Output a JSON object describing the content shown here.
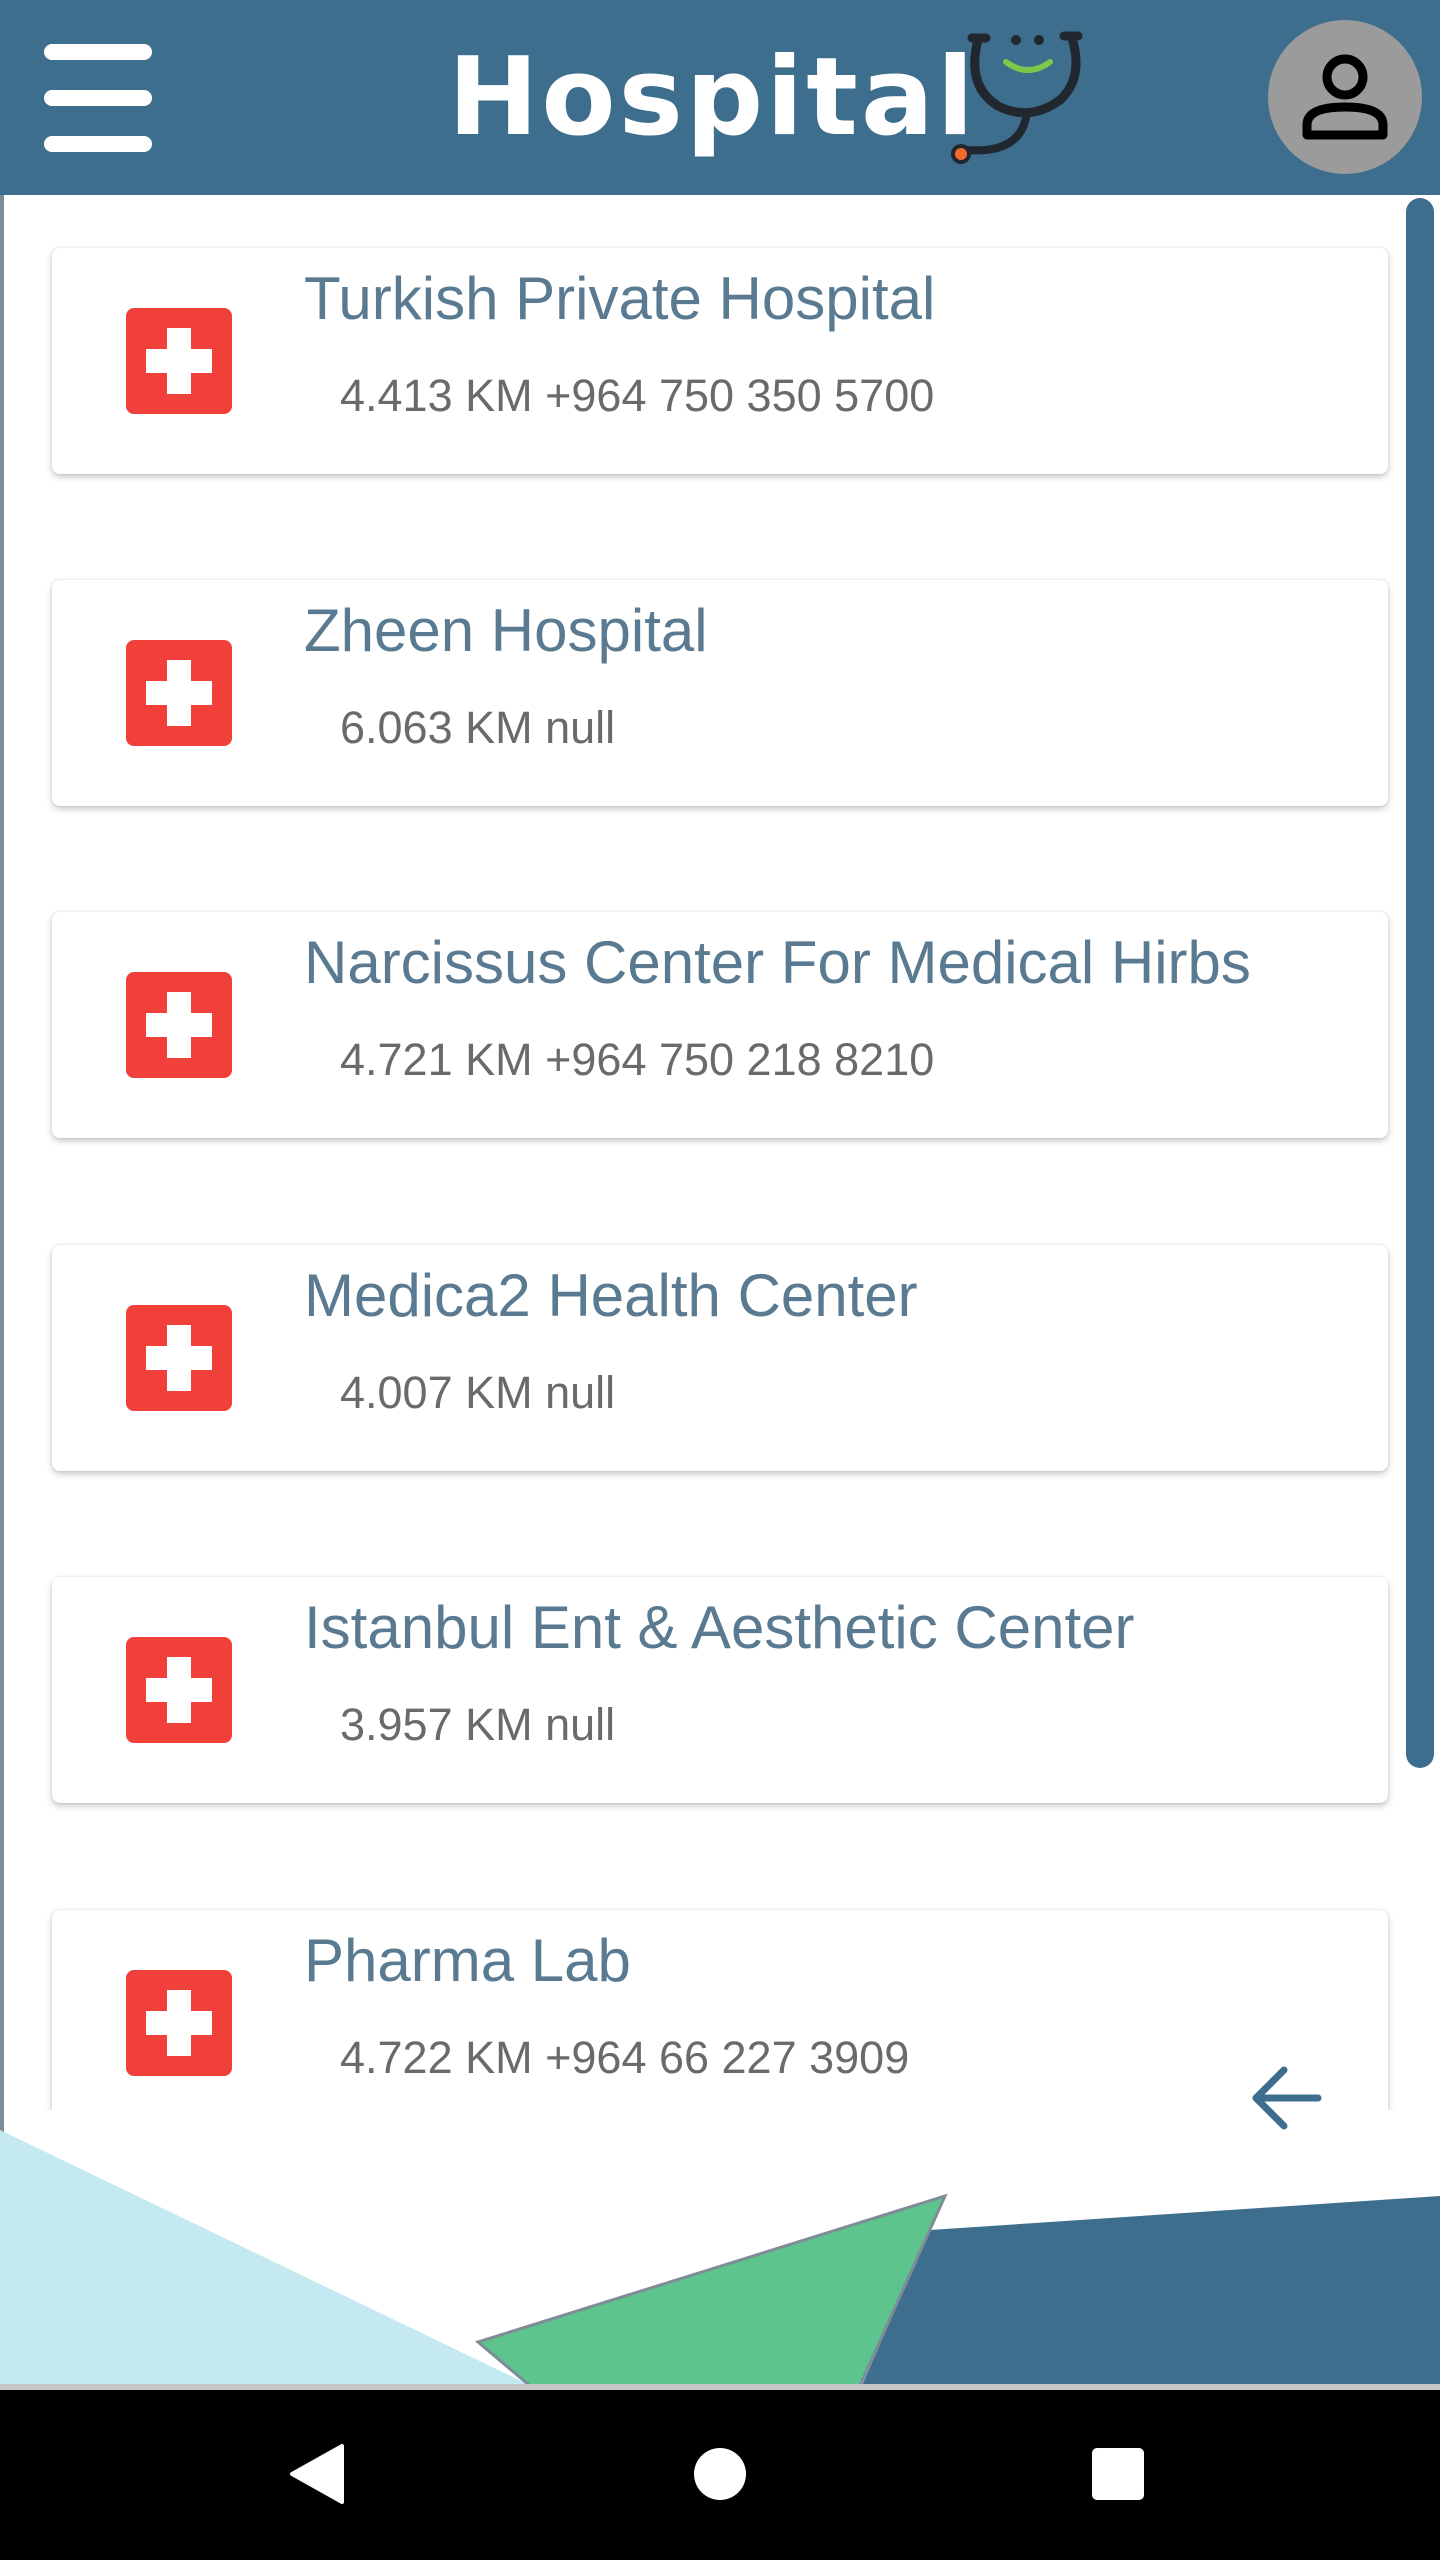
{
  "app_bar": {
    "title": "Hospital",
    "menu_icon": "hamburger-menu-icon",
    "logo_icon": "stethoscope-smile-logo",
    "profile_icon": "person-icon",
    "background_color": "#3e6e8e"
  },
  "hospitals": [
    {
      "name": "Turkish Private Hospital",
      "details": "4.413 KM +964 750 350 5700",
      "icon": "red-cross-icon"
    },
    {
      "name": "Zheen Hospital",
      "details": "6.063 KM null",
      "icon": "red-cross-icon"
    },
    {
      "name": "Narcissus Center For Medical Hirbs",
      "details": "4.721 KM +964 750 218 8210",
      "icon": "red-cross-icon"
    },
    {
      "name": "Medica2 Health Center",
      "details": "4.007 KM null",
      "icon": "red-cross-icon"
    },
    {
      "name": "Istanbul Ent & Aesthetic Center",
      "details": "3.957 KM null",
      "icon": "red-cross-icon"
    },
    {
      "name": "Pharma Lab",
      "details": "4.722 KM +964 66 227 3909",
      "icon": "red-cross-icon"
    }
  ],
  "back_icon": "arrow-left-icon",
  "colors": {
    "accent": "#3e6e8e",
    "cross_red": "#f1403a",
    "title_text": "#5a7a91",
    "light_blue_shape": "#c4e9f0",
    "green_shape": "#5cc48c"
  },
  "system_nav": {
    "back_icon": "triangle-back-icon",
    "home_icon": "circle-home-icon",
    "recents_icon": "square-recents-icon"
  }
}
